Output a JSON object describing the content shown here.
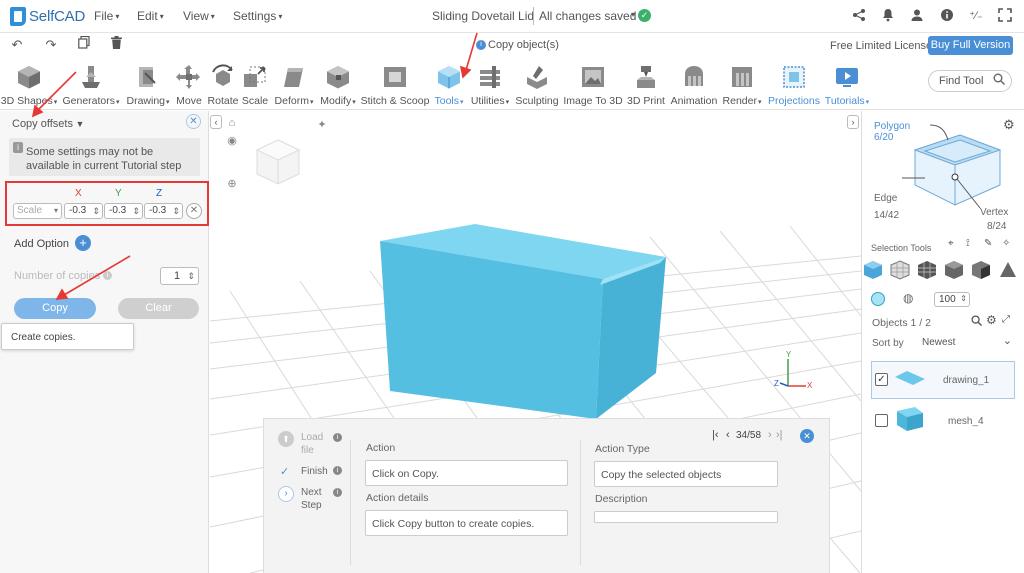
{
  "app": {
    "name": "SelfCAD",
    "document_title": "Sliding Dovetail Lid",
    "save_status": "All changes saved",
    "operation_title": "Copy object(s)",
    "license": "Free Limited License",
    "buy_label": "Buy Full Version"
  },
  "menu": [
    "File",
    "Edit",
    "View",
    "Settings"
  ],
  "toolbar": {
    "tools": [
      {
        "label": "3D Shapes",
        "icon": "cube-icon"
      },
      {
        "label": "Generators",
        "icon": "generator-icon"
      },
      {
        "label": "Drawing",
        "icon": "drawing-icon"
      },
      {
        "label": "Move",
        "icon": "move-icon"
      },
      {
        "label": "Rotate",
        "icon": "rotate-icon"
      },
      {
        "label": "Scale",
        "icon": "scale-icon"
      },
      {
        "label": "Deform",
        "icon": "deform-icon"
      },
      {
        "label": "Modify",
        "icon": "modify-icon"
      },
      {
        "label": "Stitch & Scoop",
        "icon": "stitch-icon"
      },
      {
        "label": "Tools",
        "icon": "tools-icon"
      },
      {
        "label": "Utilities",
        "icon": "utilities-icon"
      },
      {
        "label": "Sculpting",
        "icon": "sculpting-icon"
      },
      {
        "label": "Image To 3D",
        "icon": "image-icon"
      },
      {
        "label": "3D Print",
        "icon": "print-icon"
      },
      {
        "label": "Animation",
        "icon": "animation-icon"
      },
      {
        "label": "Render",
        "icon": "render-icon"
      },
      {
        "label": "Projections",
        "icon": "projections-icon"
      },
      {
        "label": "Tutorials",
        "icon": "tutorials-icon"
      }
    ],
    "find_tool_placeholder": "Find Tool"
  },
  "left_panel": {
    "title": "Copy offsets",
    "notice": "Some settings may not be available in current Tutorial step",
    "axes": {
      "x_label": "X",
      "y_label": "Y",
      "z_label": "Z",
      "x": "-0.3",
      "y": "-0.3",
      "z": "-0.3",
      "mode_placeholder": "Scale"
    },
    "add_option": "Add Option",
    "number_of_copies_label": "Number of copies",
    "number_of_copies": "1",
    "copy_label": "Copy",
    "clear_label": "Clear",
    "tooltip": "Create copies."
  },
  "tutorial": {
    "steps": [
      {
        "label": "Load file",
        "enabled": false
      },
      {
        "label": "Finish",
        "enabled": true
      },
      {
        "label": "Next Step",
        "enabled": true
      }
    ],
    "action_label": "Action",
    "action": "Click on Copy.",
    "action_details_label": "Action details",
    "action_details": "Click Copy button to create copies.",
    "action_type_label": "Action Type",
    "action_type": "Copy the selected objects",
    "description_label": "Description",
    "description": "",
    "progress": "34/58"
  },
  "right_panel": {
    "polygon_label": "Polygon",
    "polygon_count": "6/20",
    "edge_label": "Edge",
    "edge_count": "14/42",
    "vertex_label": "Vertex",
    "vertex_count": "8/24",
    "selection_tools_label": "Selection Tools",
    "opacity": "100",
    "objects_label": "Objects 1 / 2",
    "sort_label": "Sort by",
    "sort_value": "Newest",
    "objects": [
      {
        "name": "drawing_1",
        "checked": true
      },
      {
        "name": "mesh_4",
        "checked": false
      }
    ]
  },
  "colors": {
    "accent": "#4a8fd6",
    "object": "#5bc4e6",
    "highlight": "#e53935"
  }
}
